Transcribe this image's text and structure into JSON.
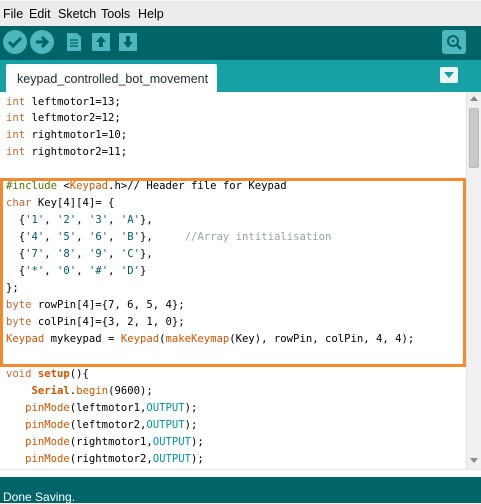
{
  "menu": {
    "items": [
      "File",
      "Edit",
      "Sketch",
      "Tools",
      "Help"
    ]
  },
  "toolbar": {
    "buttons": [
      {
        "name": "verify-icon"
      },
      {
        "name": "upload-arrow-icon"
      },
      {
        "name": "new-sketch-icon"
      },
      {
        "name": "open-sketch-icon"
      },
      {
        "name": "save-sketch-icon"
      },
      {
        "name": "serial-monitor-icon"
      }
    ]
  },
  "tab": {
    "label": "keypad_controlled_bot_movement"
  },
  "code": {
    "lines": [
      [
        {
          "t": "int",
          "c": "kw-type"
        },
        {
          "t": " leftmotor1=13;"
        }
      ],
      [
        {
          "t": "int",
          "c": "kw-type"
        },
        {
          "t": " leftmotor2=12;"
        }
      ],
      [
        {
          "t": "int",
          "c": "kw-type"
        },
        {
          "t": " rightmotor1=10;"
        }
      ],
      [
        {
          "t": "int",
          "c": "kw-type"
        },
        {
          "t": " rightmotor2=11;"
        }
      ],
      [],
      [
        {
          "t": "#include",
          "c": "kw-pre"
        },
        {
          "t": " <"
        },
        {
          "t": "Keypad",
          "c": "kw-lib"
        },
        {
          "t": ".h>// Header file for Keypad"
        }
      ],
      [
        {
          "t": "char",
          "c": "kw-type"
        },
        {
          "t": " Key[4][4]= {"
        }
      ],
      [
        {
          "t": "  {"
        },
        {
          "t": "'1'",
          "c": "kw-str"
        },
        {
          "t": ", "
        },
        {
          "t": "'2'",
          "c": "kw-str"
        },
        {
          "t": ", "
        },
        {
          "t": "'3'",
          "c": "kw-str"
        },
        {
          "t": ", "
        },
        {
          "t": "'A'",
          "c": "kw-str"
        },
        {
          "t": "},"
        }
      ],
      [
        {
          "t": "  {"
        },
        {
          "t": "'4'",
          "c": "kw-str"
        },
        {
          "t": ", "
        },
        {
          "t": "'5'",
          "c": "kw-str"
        },
        {
          "t": ", "
        },
        {
          "t": "'6'",
          "c": "kw-str"
        },
        {
          "t": ", "
        },
        {
          "t": "'B'",
          "c": "kw-str"
        },
        {
          "t": "},     "
        },
        {
          "t": "//Array intitialisation",
          "c": "kw-cmt"
        }
      ],
      [
        {
          "t": "  {"
        },
        {
          "t": "'7'",
          "c": "kw-str"
        },
        {
          "t": ", "
        },
        {
          "t": "'8'",
          "c": "kw-str"
        },
        {
          "t": ", "
        },
        {
          "t": "'9'",
          "c": "kw-str"
        },
        {
          "t": ", "
        },
        {
          "t": "'C'",
          "c": "kw-str"
        },
        {
          "t": "},"
        }
      ],
      [
        {
          "t": "  {"
        },
        {
          "t": "'*'",
          "c": "kw-str"
        },
        {
          "t": ", "
        },
        {
          "t": "'0'",
          "c": "kw-str"
        },
        {
          "t": ", "
        },
        {
          "t": "'#'",
          "c": "kw-str"
        },
        {
          "t": ", "
        },
        {
          "t": "'D'",
          "c": "kw-str"
        },
        {
          "t": "}"
        }
      ],
      [
        {
          "t": "};"
        }
      ],
      [
        {
          "t": "byte",
          "c": "kw-type"
        },
        {
          "t": " rowPin[4]={7, 6, 5, 4};"
        }
      ],
      [
        {
          "t": "byte",
          "c": "kw-type"
        },
        {
          "t": " colPin[4]={3, 2, 1, 0};"
        }
      ],
      [
        {
          "t": "Keypad",
          "c": "kw-lib"
        },
        {
          "t": " mykeypad = "
        },
        {
          "t": "Keypad",
          "c": "kw-lib"
        },
        {
          "t": "("
        },
        {
          "t": "makeKeymap",
          "c": "kw-fn"
        },
        {
          "t": "(Key), rowPin, colPin, 4, 4);"
        }
      ],
      [],
      [
        {
          "t": "void",
          "c": "kw-type"
        },
        {
          "t": " "
        },
        {
          "t": "setup",
          "c": "kw-cls"
        },
        {
          "t": "(){"
        }
      ],
      [
        {
          "t": "    "
        },
        {
          "t": "Serial",
          "c": "kw-cls"
        },
        {
          "t": "."
        },
        {
          "t": "begin",
          "c": "kw-fn"
        },
        {
          "t": "(9600);"
        }
      ],
      [
        {
          "t": "   "
        },
        {
          "t": "pinMode",
          "c": "kw-fn"
        },
        {
          "t": "(leftmotor1,"
        },
        {
          "t": "OUTPUT",
          "c": "kw-const"
        },
        {
          "t": ");"
        }
      ],
      [
        {
          "t": "   "
        },
        {
          "t": "pinMode",
          "c": "kw-fn"
        },
        {
          "t": "(leftmotor2,"
        },
        {
          "t": "OUTPUT",
          "c": "kw-const"
        },
        {
          "t": ");"
        }
      ],
      [
        {
          "t": "   "
        },
        {
          "t": "pinMode",
          "c": "kw-fn"
        },
        {
          "t": "(rightmotor1,"
        },
        {
          "t": "OUTPUT",
          "c": "kw-const"
        },
        {
          "t": ");"
        }
      ],
      [
        {
          "t": "   "
        },
        {
          "t": "pinMode",
          "c": "kw-fn"
        },
        {
          "t": "(rightmotor2,"
        },
        {
          "t": "OUTPUT",
          "c": "kw-const"
        },
        {
          "t": ");"
        }
      ]
    ]
  },
  "status": {
    "message": "Done Saving."
  },
  "colors": {
    "toolbar": "#006468",
    "tabbar": "#17a1a5",
    "button": "#4db7bb",
    "highlight": "#f28b30"
  }
}
